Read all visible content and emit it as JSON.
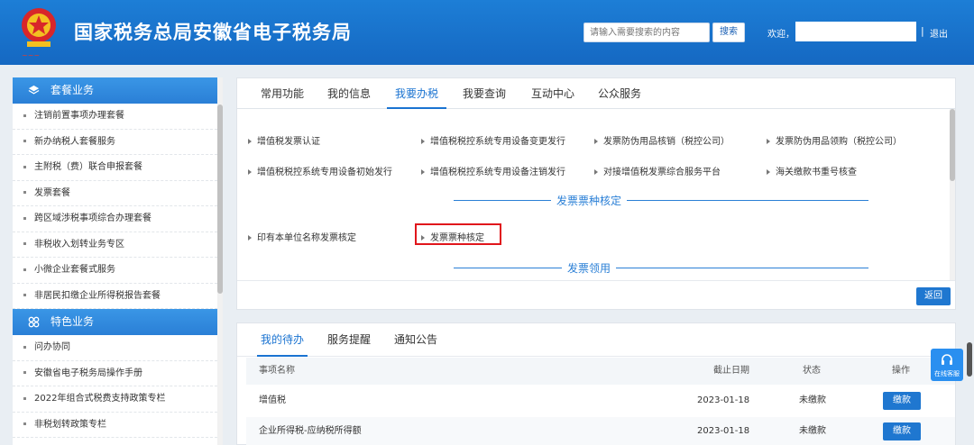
{
  "header": {
    "title": "国家税务总局安徽省电子税务局",
    "search_placeholder": "请输入需要搜索的内容",
    "search_button": "搜索",
    "welcome": "欢迎，",
    "separator": "|",
    "logout": "退出",
    "colors": {
      "header_bg": "#1d7ed6"
    }
  },
  "sidebar": {
    "sections": [
      {
        "title": "套餐业务",
        "icon": "layers-icon",
        "items": [
          "注销前置事项办理套餐",
          "新办纳税人套餐服务",
          "主附税（费）联合申报套餐",
          "发票套餐",
          "跨区域涉税事项综合办理套餐",
          "非税收入划转业务专区",
          "小微企业套餐式服务",
          "非居民扣缴企业所得税报告套餐"
        ]
      },
      {
        "title": "特色业务",
        "icon": "grid-icon",
        "items": [
          "问办协同",
          "安徽省电子税务局操作手册",
          "2022年组合式税费支持政策专栏",
          "非税划转政策专栏"
        ]
      }
    ]
  },
  "main": {
    "tabs": [
      "常用功能",
      "我的信息",
      "我要办税",
      "我要查询",
      "互动中心",
      "公众服务"
    ],
    "active_tab": "我要办税",
    "links_row1": [
      "增值税发票认证",
      "增值税税控系统专用设备变更发行",
      "发票防伪用品核销（税控公司）",
      "发票防伪用品领购（税控公司）"
    ],
    "links_row2": [
      "增值税税控系统专用设备初始发行",
      "增值税税控系统专用设备注销发行",
      "对接增值税发票综合服务平台",
      "海关缴款书重号核查"
    ],
    "section_invoice_type": "发票票种核定",
    "links_row3": [
      "印有本单位名称发票核定",
      "发票票种核定"
    ],
    "section_invoice_collect": "发票领用",
    "back_button": "返回",
    "highlight_color": "#e0161c"
  },
  "todo": {
    "tabs": [
      "我的待办",
      "服务提醒",
      "通知公告"
    ],
    "active_tab": "我的待办",
    "columns": [
      "事项名称",
      "截止日期",
      "状态",
      "操作"
    ],
    "rows": [
      {
        "name": "增值税",
        "deadline": "2023-01-18",
        "status": "未缴款",
        "action": "缴款"
      },
      {
        "name": "企业所得税-应纳税所得额",
        "deadline": "2023-01-18",
        "status": "未缴款",
        "action": "缴款"
      }
    ]
  },
  "float_service": {
    "label": "在线客服",
    "icon": "headset-icon"
  }
}
